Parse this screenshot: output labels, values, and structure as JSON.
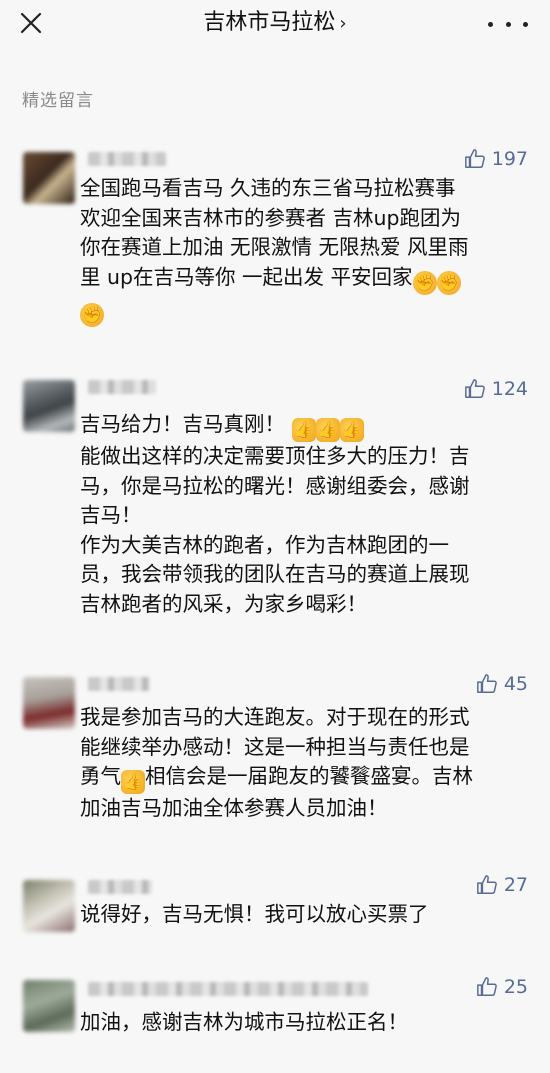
{
  "header": {
    "title": "吉林市马拉松",
    "chevron": "›",
    "close_icon": "close-icon",
    "more_icon": "more-icon"
  },
  "section_label": "精选留言",
  "comments": [
    {
      "likes": "197",
      "lines": [
        "全国跑马看吉马 久违的东三省马拉松赛事",
        "欢迎全国来吉林市的参赛者 吉林up跑团为",
        "你在赛道上加油 无限激情 无限热爱 风里雨",
        "里 up在吉马等你 一起出发 平安回家"
      ],
      "emoji": [
        "fist",
        "fist",
        "fist"
      ]
    },
    {
      "likes": "124",
      "lines": [
        "吉马给力！吉马真刚！",
        "能做出这样的决定需要顶住多大的压力！吉",
        "马，你是马拉松的曙光！感谢组委会，感谢",
        "吉马！",
        "作为大美吉林的跑者，作为吉林跑团的一",
        "员，我会带领我的团队在吉马的赛道上展现",
        "吉林跑者的风采，为家乡喝彩！"
      ],
      "emoji": [
        "thumb",
        "thumb",
        "thumb"
      ]
    },
    {
      "likes": "45",
      "lines": [
        "我是参加吉马的大连跑友。对于现在的形式",
        "能继续举办感动！这是一种担当与责任也是",
        "勇气",
        "相信会是一届跑友的饕餮盛宴。吉林",
        "加油吉马加油全体参赛人员加油！"
      ],
      "emoji": [
        "thumb"
      ]
    },
    {
      "likes": "27",
      "lines": [
        "说得好，吉马无惧！我可以放心买票了"
      ]
    },
    {
      "likes": "25",
      "lines": [
        "加油，感谢吉林为城市马拉松正名！"
      ]
    }
  ],
  "colors": {
    "background": "#f7f7f7",
    "likes": "#576b95",
    "section_label": "#8a8a8a"
  }
}
